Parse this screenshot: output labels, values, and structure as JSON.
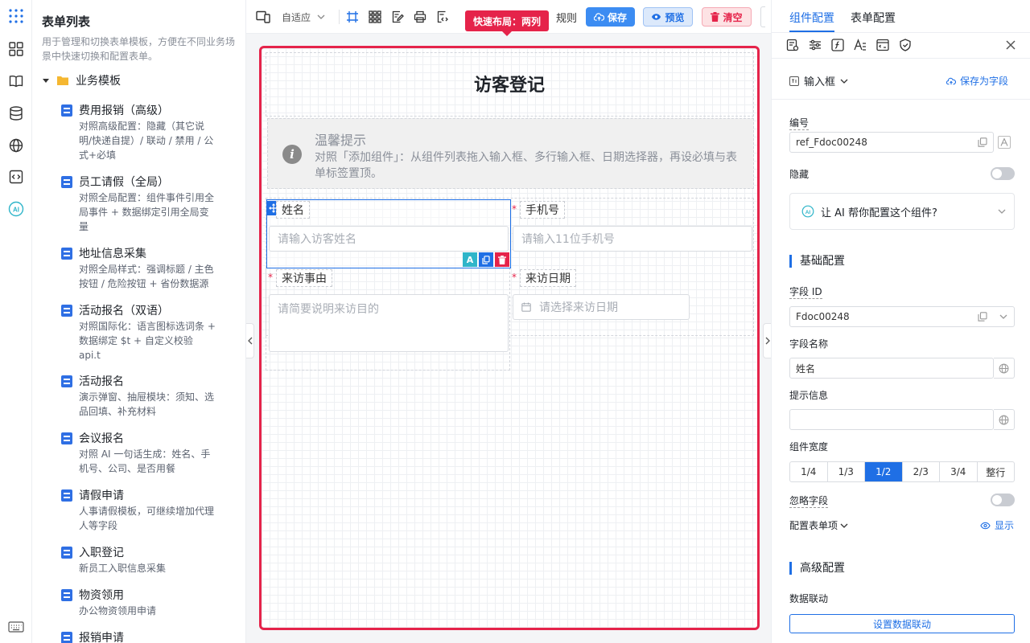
{
  "list_panel": {
    "title": "表单列表",
    "description": "用于管理和切换表单模板，方便在不同业务场景中快速切换和配置表单。",
    "group": "业务模板",
    "items": [
      {
        "name": "费用报销（高级）",
        "desc": "对照高级配置：隐藏（其它说明/快递自提）/ 联动 / 禁用 / 公式+必填"
      },
      {
        "name": "员工请假（全局）",
        "desc": "对照全局配置：组件事件引用全局事件 + 数据绑定引用全局变量"
      },
      {
        "name": "地址信息采集",
        "desc": "对照全局样式：强调标题 / 主色按钮 / 危险按钮 + 省份数据源"
      },
      {
        "name": "活动报名（双语）",
        "desc": "对照国际化：语言图标选词条 + 数据绑定 $t + 自定义校验 api.t"
      },
      {
        "name": "活动报名",
        "desc": "演示弹窗、抽屉模块：须知、选品回填、补充材料"
      },
      {
        "name": "会议报名",
        "desc": "对照 AI 一句话生成：姓名、手机号、公司、是否用餐"
      },
      {
        "name": "请假申请",
        "desc": "人事请假模板，可继续增加代理人等字段"
      },
      {
        "name": "入职登记",
        "desc": "新员工入职信息采集"
      },
      {
        "name": "物资领用",
        "desc": "办公物资领用申请"
      },
      {
        "name": "报销申请",
        "desc": ""
      }
    ]
  },
  "toolbar": {
    "adaptive_label": "自适应",
    "rules_label": "规则",
    "save_label": "保存",
    "preview_label": "预览",
    "clear_label": "清空",
    "tooltip": "快速布局：两列"
  },
  "form": {
    "title": "访客登记",
    "notice_title": "温馨提示",
    "notice_text": "对照「添加组件」：从组件列表拖入输入框、多行输入框、日期选择器，再设必填与表单标签置顶。",
    "fields": {
      "name_label": "姓名",
      "name_placeholder": "请输入访客姓名",
      "phone_label": "手机号",
      "phone_placeholder": "请输入11位手机号",
      "reason_label": "来访事由",
      "reason_placeholder": "请简要说明来访目的",
      "date_label": "来访日期",
      "date_placeholder": "请选择来访日期"
    },
    "required_mark": "*",
    "ai_badge": "A"
  },
  "right_panel": {
    "tabs": [
      "组件配置",
      "表单配置"
    ],
    "component_type": "输入框",
    "save_as_field": "保存为字段",
    "ref_label": "编号",
    "ref_value": "ref_Fdoc00248",
    "hidden_label": "隐藏",
    "ai_config_text": "让 AI 帮你配置这个组件?",
    "basic_section": "基础配置",
    "field_id_label": "字段 ID",
    "field_id_value": "Fdoc00248",
    "field_name_label": "字段名称",
    "field_name_value": "姓名",
    "hint_label": "提示信息",
    "hint_value": "",
    "width_label": "组件宽度",
    "width_options": [
      "1/4",
      "1/3",
      "1/2",
      "2/3",
      "3/4",
      "整行"
    ],
    "width_selected": "1/2",
    "ignore_label": "忽略字段",
    "config_items_label": "配置表单项",
    "show_label": "显示",
    "advanced_section": "高级配置",
    "linkage_label": "数据联动",
    "linkage_button": "设置数据联动"
  },
  "colors": {
    "accent": "#1f6fe5",
    "danger": "#e5234a",
    "warning_tip": "#e5234a"
  }
}
